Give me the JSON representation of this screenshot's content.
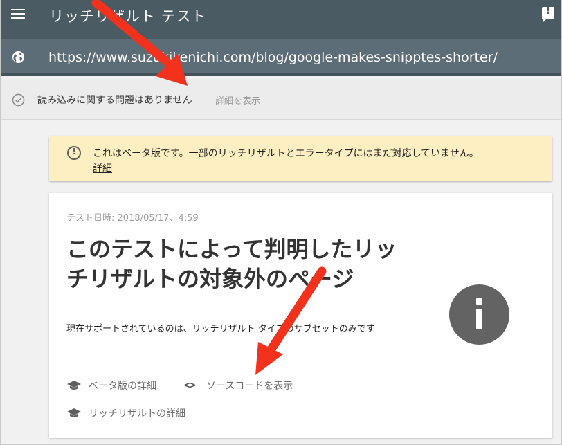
{
  "appbar": {
    "title": "リッチリザルト テスト",
    "menu_icon": "hamburger-menu-icon",
    "feedback_icon": "feedback-icon"
  },
  "urlbar": {
    "icon": "globe-icon",
    "url": "https://www.suzukikenichi.com/blog/google-makes-snipptes-shorter/"
  },
  "status": {
    "icon": "check-circle-icon",
    "text": "読み込みに関する問題はありません",
    "details_link": "詳細を表示"
  },
  "banner": {
    "icon": "info-outline-icon",
    "text": "これはベータ版です。一部のリッチリザルトとエラータイプにはまだ対応していません。",
    "link": "詳細"
  },
  "card": {
    "test_date": "テスト日時: 2018/05/17、4:59",
    "title": "このテストによって判明したリッチリザルトの対象外のページ",
    "description": "現在サポートされているのは、リッチリザルト タイプのサブセットのみです",
    "links": {
      "beta_details": "ベータ版の詳細",
      "view_source": "ソースコードを表示",
      "rich_results_details": "リッチリザルトの詳細"
    },
    "result_icon": "info-filled-icon"
  },
  "colors": {
    "appbar": "#4b5b64",
    "urlbar": "#5d6d77",
    "banner": "#fdefc1",
    "arrow": "#f2321c"
  }
}
